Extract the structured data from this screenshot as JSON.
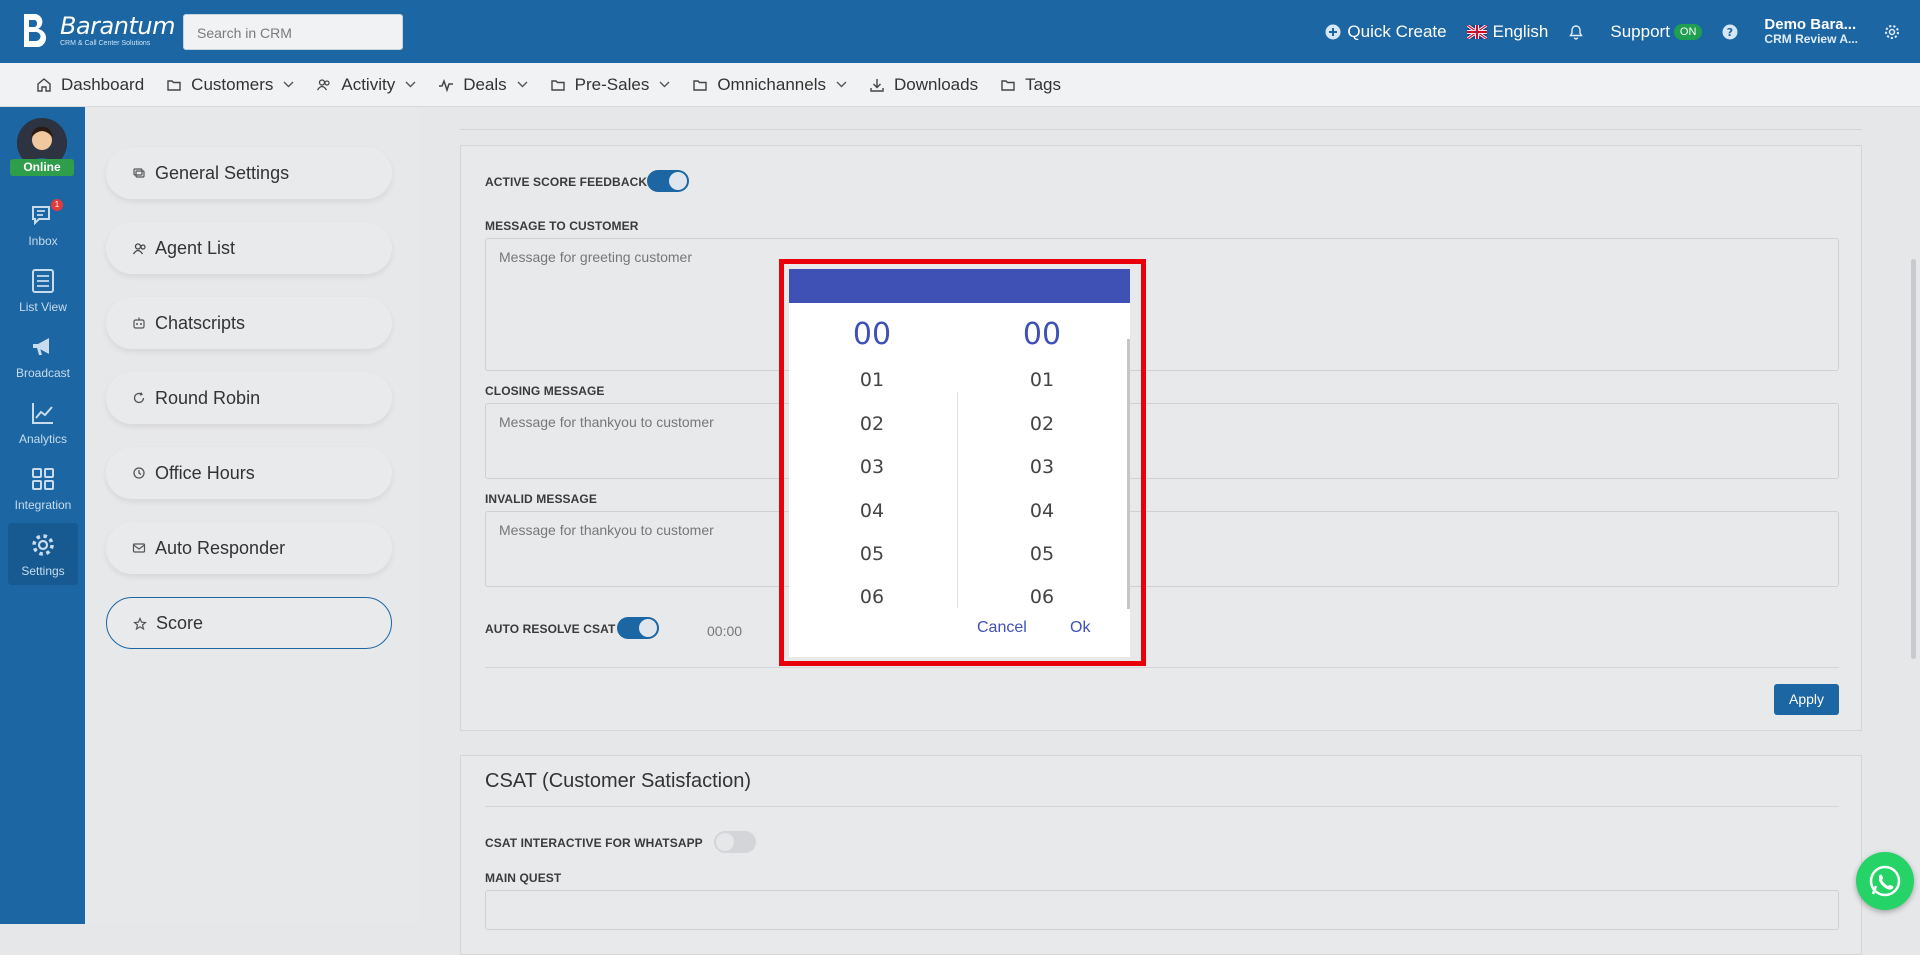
{
  "app": {
    "name": "Barantum",
    "tagline": "CRM & Call Center Solutions"
  },
  "topbar": {
    "search_placeholder": "Search in CRM",
    "quick_create": "Quick Create",
    "language": "English",
    "support": "Support",
    "support_badge": "ON",
    "user_name": "Demo Bara...",
    "user_org": "CRM Review A..."
  },
  "menu": {
    "items": [
      {
        "label": "Dashboard",
        "icon": "home-icon",
        "dropdown": false
      },
      {
        "label": "Customers",
        "icon": "folder-icon",
        "dropdown": true
      },
      {
        "label": "Activity",
        "icon": "users-icon",
        "dropdown": true
      },
      {
        "label": "Deals",
        "icon": "activity-icon",
        "dropdown": true
      },
      {
        "label": "Pre-Sales",
        "icon": "folder-icon",
        "dropdown": true
      },
      {
        "label": "Omnichannels",
        "icon": "folder-icon",
        "dropdown": true
      },
      {
        "label": "Downloads",
        "icon": "download-icon",
        "dropdown": false
      },
      {
        "label": "Tags",
        "icon": "folder-icon",
        "dropdown": false
      }
    ]
  },
  "leftnav": {
    "status": "Online",
    "inbox_count": "1",
    "items": [
      {
        "label": "Inbox",
        "icon": "chat-icon"
      },
      {
        "label": "List View",
        "icon": "list-icon"
      },
      {
        "label": "Broadcast",
        "icon": "megaphone-icon"
      },
      {
        "label": "Analytics",
        "icon": "chart-icon"
      },
      {
        "label": "Integration",
        "icon": "grid-icon"
      },
      {
        "label": "Settings",
        "icon": "gear-icon"
      }
    ]
  },
  "settings_menu": {
    "items": [
      {
        "label": "General Settings",
        "icon": "settings-icon"
      },
      {
        "label": "Agent List",
        "icon": "users-icon"
      },
      {
        "label": "Chatscripts",
        "icon": "robot-icon"
      },
      {
        "label": "Round Robin",
        "icon": "refresh-icon"
      },
      {
        "label": "Office Hours",
        "icon": "clock-icon"
      },
      {
        "label": "Auto Responder",
        "icon": "mail-icon"
      },
      {
        "label": "Score",
        "icon": "star-icon"
      }
    ],
    "active": "Score"
  },
  "score_form": {
    "active_score_feedback": "ACTIVE SCORE FEEDBACK",
    "active_score_feedback_on": true,
    "message_to_customer_label": "MESSAGE TO CUSTOMER",
    "message_to_customer_placeholder": "Message for greeting customer",
    "closing_message_label": "CLOSING MESSAGE",
    "closing_message_placeholder": "Message for thankyou to customer",
    "invalid_message_label": "INVALID MESSAGE",
    "invalid_message_placeholder": "Message for thankyou to customer",
    "auto_resolve_label": "AUTO RESOLVE CSAT",
    "auto_resolve_on": true,
    "auto_resolve_time": "00:00",
    "apply_label": "Apply"
  },
  "csat": {
    "title": "CSAT (Customer Satisfaction)",
    "interactive_label": "CSAT INTERACTIVE FOR WHATSAPP",
    "interactive_on": false,
    "main_quest_label": "MAIN QUEST"
  },
  "time_picker": {
    "hours": {
      "selected": "00",
      "options": [
        "01",
        "02",
        "03",
        "04",
        "05",
        "06"
      ]
    },
    "minutes": {
      "selected": "00",
      "options": [
        "01",
        "02",
        "03",
        "04",
        "05",
        "06"
      ]
    },
    "cancel": "Cancel",
    "ok": "Ok",
    "accent": "#3f51b5"
  },
  "colors": {
    "brand": "#1b66a3",
    "highlight_border": "#e8000a",
    "whatsapp": "#25d366"
  }
}
